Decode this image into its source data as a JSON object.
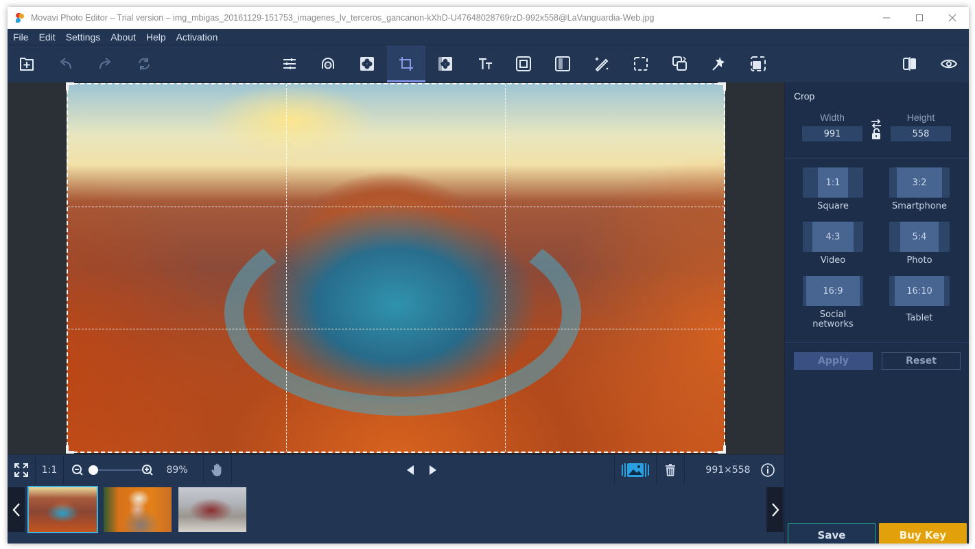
{
  "window": {
    "title": "Movavi Photo Editor – Trial version – img_mbigas_20161129-151753_imagenes_lv_terceros_gancanon-kXhD-U47648028769rzD-992x558@LaVanguardia-Web.jpg",
    "controls": [
      "minimize",
      "maximize",
      "close"
    ]
  },
  "menu": {
    "items": [
      "File",
      "Edit",
      "Settings",
      "About",
      "Help",
      "Activation"
    ]
  },
  "toolbar": {
    "left": [
      {
        "name": "add-file",
        "icon": "add-file-icon"
      },
      {
        "name": "undo",
        "icon": "undo-icon"
      },
      {
        "name": "redo",
        "icon": "redo-icon"
      },
      {
        "name": "reset",
        "icon": "reset-icon"
      }
    ],
    "tools": [
      {
        "name": "adjust",
        "icon": "sliders-icon"
      },
      {
        "name": "retouch",
        "icon": "face-icon"
      },
      {
        "name": "effects",
        "icon": "effects-icon"
      },
      {
        "name": "crop",
        "icon": "crop-icon",
        "active": true
      },
      {
        "name": "background",
        "icon": "background-icon"
      },
      {
        "name": "text",
        "icon": "text-icon"
      },
      {
        "name": "frames",
        "icon": "frame-icon"
      },
      {
        "name": "blur",
        "icon": "blur-icon"
      },
      {
        "name": "magic-enhance",
        "icon": "magic-wand-icon"
      },
      {
        "name": "selection",
        "icon": "selection-icon"
      },
      {
        "name": "resize",
        "icon": "resize-icon"
      },
      {
        "name": "object-removal",
        "icon": "pin-icon"
      },
      {
        "name": "transform",
        "icon": "transform-icon"
      }
    ],
    "right": [
      {
        "name": "compare",
        "icon": "compare-icon"
      },
      {
        "name": "preview",
        "icon": "eye-icon"
      }
    ]
  },
  "bottombar": {
    "fit_label": "1:1",
    "zoom_percent": "89%",
    "zoom_value": 0.06,
    "dimensions": "991×558"
  },
  "filmstrip": {
    "thumbnails": [
      {
        "name": "canyon",
        "selected": true
      },
      {
        "name": "portrait",
        "selected": false
      },
      {
        "name": "car",
        "selected": false
      }
    ]
  },
  "panel": {
    "title": "Crop",
    "width_label": "Width",
    "height_label": "Height",
    "width_value": "991",
    "height_value": "558",
    "ratios": [
      {
        "ratio": "1:1",
        "label": "Square"
      },
      {
        "ratio": "3:2",
        "label": "Smartphone"
      },
      {
        "ratio": "4:3",
        "label": "Video"
      },
      {
        "ratio": "5:4",
        "label": "Photo"
      },
      {
        "ratio": "16:9",
        "label": "Social networks"
      },
      {
        "ratio": "16:10",
        "label": "Tablet"
      }
    ],
    "apply_label": "Apply",
    "reset_label": "Reset",
    "save_label": "Save",
    "buy_label": "Buy Key"
  },
  "colors": {
    "accent": "#7a8ee0",
    "buy": "#e2a00a",
    "save_border": "#2aa58c",
    "selected_thumb": "#3fb5e0"
  }
}
